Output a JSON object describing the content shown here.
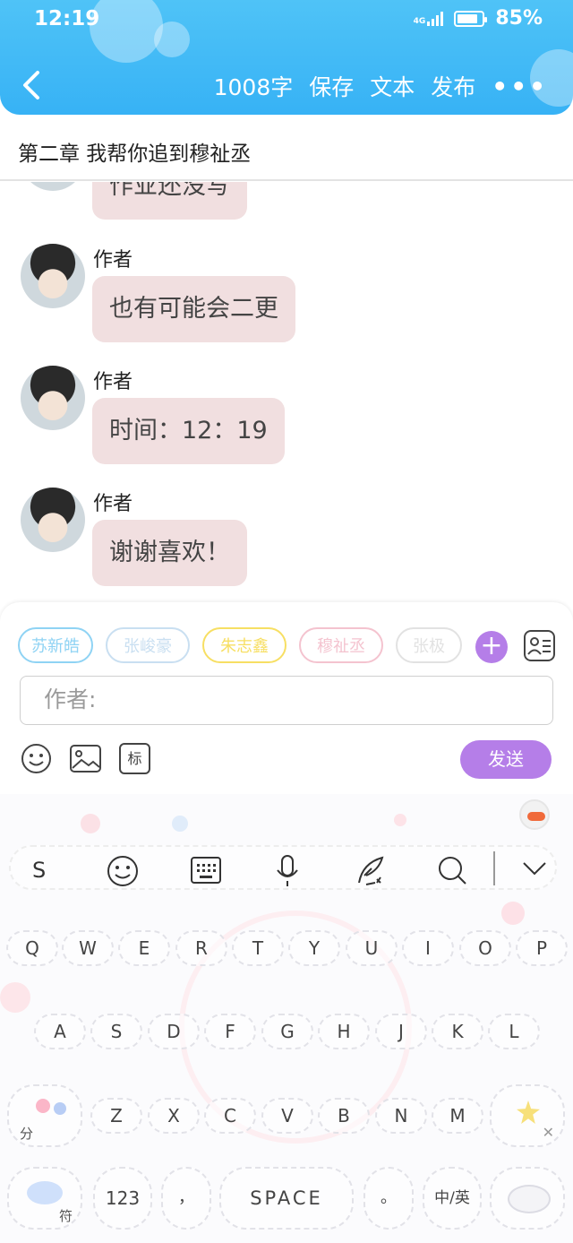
{
  "status_bar": {
    "time": "12:19",
    "network": "4G",
    "battery_label": "85%",
    "battery_level": 0.85
  },
  "header": {
    "word_count": "1008字",
    "save": "保存",
    "text": "文本",
    "publish": "发布"
  },
  "chapter": {
    "title": "第二章 我帮你追到穆祉丞"
  },
  "messages": [
    {
      "author": "",
      "text": "作业还没写"
    },
    {
      "author": "作者",
      "text": "也有可能会二更"
    },
    {
      "author": "作者",
      "text": "时间：12：19"
    },
    {
      "author": "作者",
      "text": "谢谢喜欢！"
    }
  ],
  "characters": [
    {
      "name": "苏新皓",
      "color": "#8fd3f4"
    },
    {
      "name": "张峻豪",
      "color": "#c9dff1"
    },
    {
      "name": "朱志鑫",
      "color": "#f7df63"
    },
    {
      "name": "穆祉丞",
      "color": "#f4c3cf"
    },
    {
      "name": "张极",
      "color": "#e2e2e2"
    }
  ],
  "composer": {
    "placeholder": "作者:",
    "tag_label": "标",
    "send": "发送"
  },
  "keyboard": {
    "toolbar": {
      "s": "S"
    },
    "row1": [
      "Q",
      "W",
      "E",
      "R",
      "T",
      "Y",
      "U",
      "I",
      "O",
      "P"
    ],
    "row2": [
      "A",
      "S",
      "D",
      "F",
      "G",
      "H",
      "J",
      "K",
      "L"
    ],
    "row3": [
      "Z",
      "X",
      "C",
      "V",
      "B",
      "N",
      "M"
    ],
    "fen": "分",
    "fu": "符",
    "num": "123",
    "comma": "，",
    "space": "SPACE",
    "period": "。",
    "lang": "中/英"
  },
  "colors": {
    "header": "#37b2f5",
    "accent": "#b57ee8",
    "bubble": "#f1dfe0"
  }
}
